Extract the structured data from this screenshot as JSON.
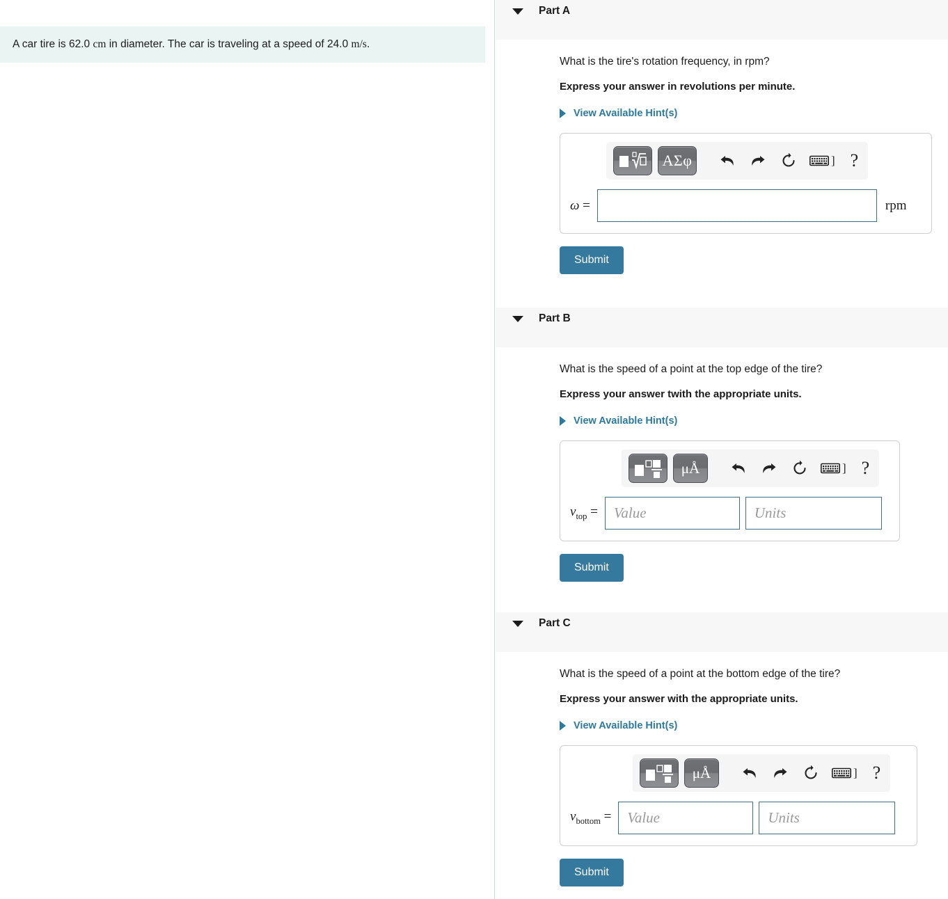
{
  "problem": {
    "text_before_cm": "A car tire is 62.0 ",
    "unit_cm": "cm",
    "text_middle": " in diameter. The car is traveling at a speed of 24.0 ",
    "unit_speed_num": "m",
    "unit_speed_den": "s",
    "text_after": "."
  },
  "toolbar": {
    "template_icon": "math-template-icon",
    "greek_label": "ΑΣφ",
    "units_label": "μÅ",
    "undo_icon": "undo-icon",
    "redo_icon": "redo-icon",
    "reset_icon": "reset-icon",
    "keyboard_icon": "keyboard-icon",
    "keyboard_bracket": "]",
    "help_label": "?"
  },
  "parts": [
    {
      "id": "a",
      "title": "Part A",
      "question": "What is the tire's rotation frequency, in rpm?",
      "question_math": "rpm",
      "instruction": "Express your answer in revolutions per minute.",
      "hint_label": "View Available Hint(s)",
      "variable": "ω",
      "variable_sub": "",
      "equals": " = ",
      "answer_placeholder": "",
      "answer_value": "",
      "unit_suffix": "rpm",
      "submit_label": "Submit"
    },
    {
      "id": "b",
      "title": "Part B",
      "question": "What is the speed of a point at the top edge of the tire?",
      "instruction": "Express your answer twith the appropriate units.",
      "hint_label": "View Available Hint(s)",
      "variable": "v",
      "variable_sub": "top",
      "equals": " = ",
      "value_placeholder": "Value",
      "units_placeholder": "Units",
      "value": "",
      "units": "",
      "submit_label": "Submit"
    },
    {
      "id": "c",
      "title": "Part C",
      "question": "What is the speed of a point at the bottom edge of the tire?",
      "instruction": "Express your answer with the appropriate units.",
      "hint_label": "View Available Hint(s)",
      "variable": "v",
      "variable_sub": "bottom",
      "equals": " = ",
      "value_placeholder": "Value",
      "units_placeholder": "Units",
      "value": "",
      "units": "",
      "submit_label": "Submit"
    }
  ],
  "colors": {
    "accent": "#36799e",
    "link": "#2d7a9c",
    "problem_bg": "#e9f4f3",
    "header_bg": "#f7f7f7",
    "field_border": "#3f6e86"
  }
}
